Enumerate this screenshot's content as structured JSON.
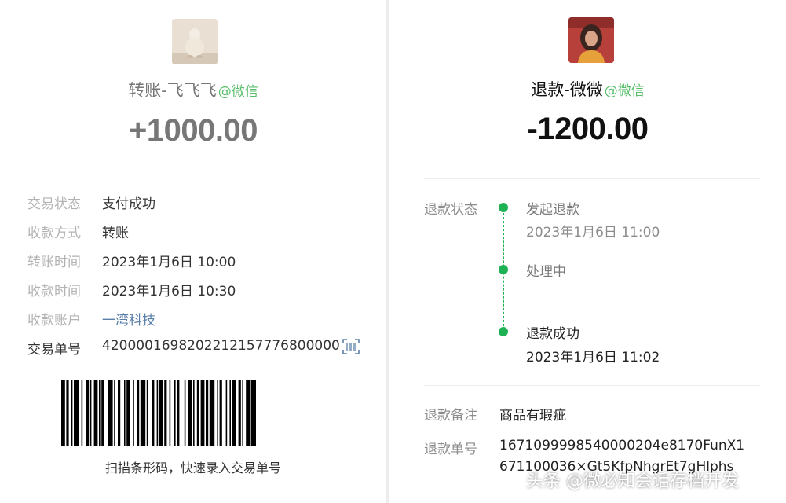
{
  "transfer": {
    "title": "转账-飞飞飞",
    "wechat_tag": "@微信",
    "amount": "+1000.00",
    "details": [
      {
        "label": "交易状态",
        "value": "支付成功"
      },
      {
        "label": "收款方式",
        "value": "转账"
      },
      {
        "label": "转账时间",
        "value": "2023年1月6日 10:00"
      },
      {
        "label": "收款时间",
        "value": "2023年1月6日 10:30"
      },
      {
        "label": "收款账户",
        "value": "一湾科技"
      },
      {
        "label": "交易单号",
        "value": "4200001698202212157776800000"
      }
    ],
    "barcode_caption": "扫描条形码，快速录入交易单号",
    "barcode_icon": "barcode-scan-icon"
  },
  "refund": {
    "title": "退款-微微",
    "wechat_tag": "@微信",
    "amount": "-1200.00",
    "status_label": "退款状态",
    "timeline": [
      {
        "title": "发起退款",
        "time": "2023年1月6日 11:00"
      },
      {
        "title": "处理中",
        "time": ""
      },
      {
        "title": "退款成功",
        "time": "2023年1月6日 11:02"
      }
    ],
    "note_label": "退款备注",
    "note_value": "商品有瑕疵",
    "order_label": "退款单号",
    "order_line1": "1671099998540000204e8170FunX1",
    "order_line2": "671100036×Gt5KfpNhgrEt7gHlphs"
  },
  "watermark": "头条 @微必知会话存档开发",
  "colors": {
    "wechat_green": "#57be6a",
    "timeline_green": "#1fb255",
    "link_blue": "#5a7fa8"
  }
}
